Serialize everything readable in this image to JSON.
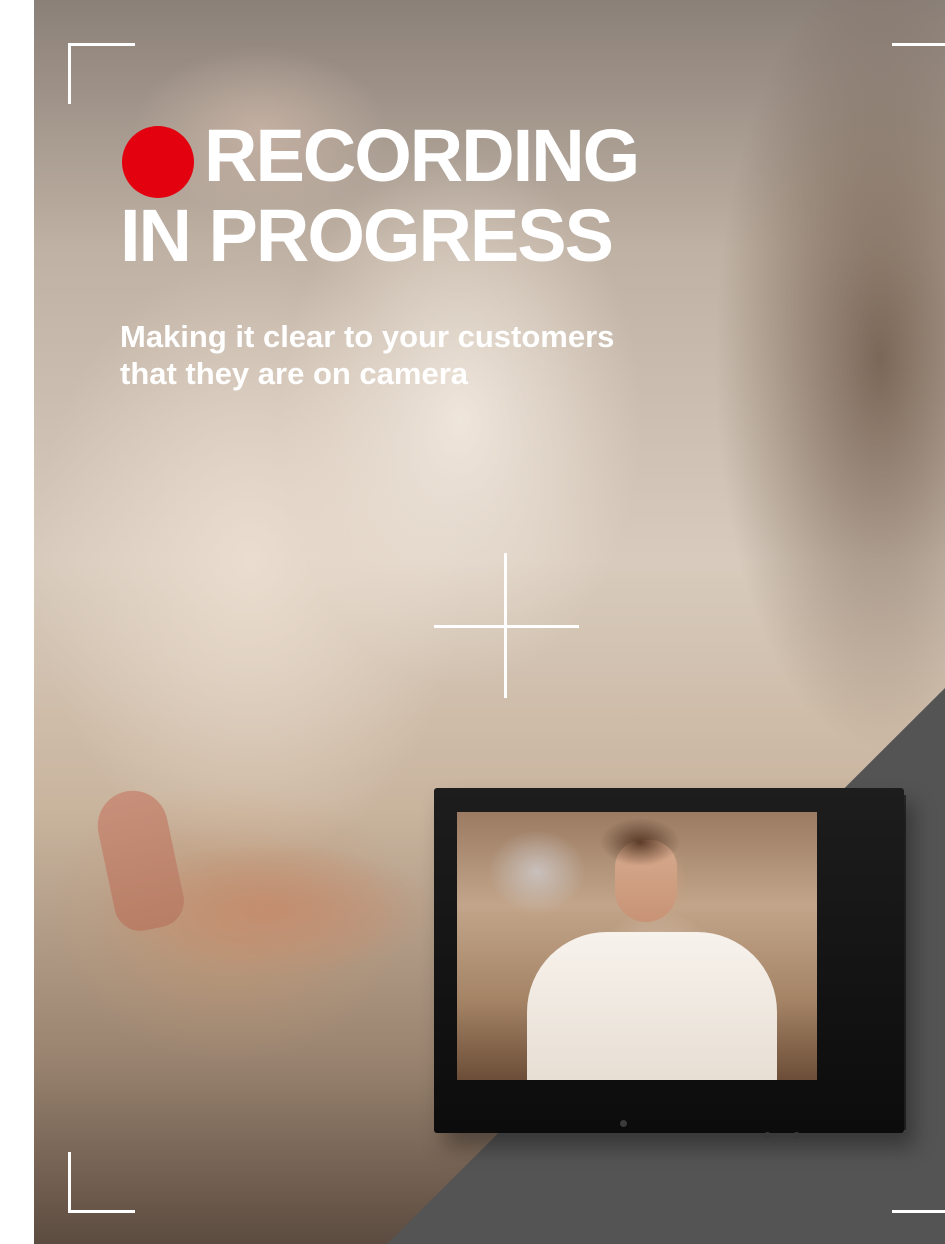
{
  "headline": {
    "line1": "RECORDING",
    "line2": "IN PROGRESS"
  },
  "subheadline": {
    "line1": "Making it clear to your customers",
    "line2": "that they are on camera"
  },
  "colors": {
    "record_dot": "#e3000f",
    "overlay_text": "#ffffff",
    "corner_panel": "#545454"
  },
  "icons": {
    "record": "red-record-dot",
    "focus_corners": "camera-viewfinder-corners",
    "focus_center": "crosshair"
  }
}
